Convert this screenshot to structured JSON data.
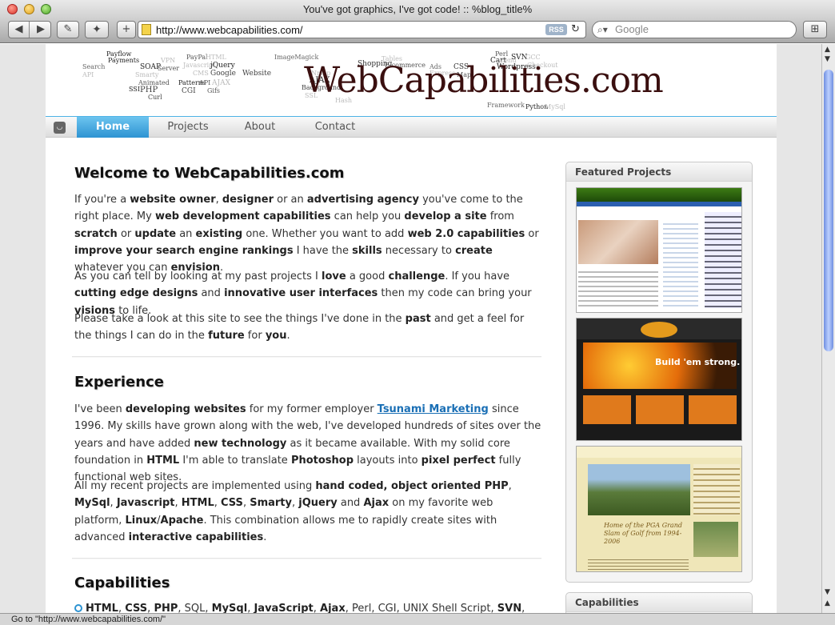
{
  "window": {
    "title": "You've got graphics, I've got code! :: %blog_title%"
  },
  "toolbar": {
    "url": "http://www.webcapabilities.com/",
    "rss": "RSS",
    "search_placeholder": "Google"
  },
  "status": {
    "text": "Go to \"http://www.webcapabilities.com/\""
  },
  "banner": {
    "logo": "WebCapabilities.com",
    "tags": [
      {
        "t": "Payflow",
        "s": 8,
        "c": "#222"
      },
      {
        "t": "Payments",
        "s": 8,
        "c": "#222"
      },
      {
        "t": "Search",
        "s": 8,
        "c": "#666"
      },
      {
        "t": "API",
        "s": 8,
        "c": "#bbb"
      },
      {
        "t": "VPN",
        "s": 8,
        "c": "#bbb"
      },
      {
        "t": "SOAP",
        "s": 9,
        "c": "#222"
      },
      {
        "t": "Smarty",
        "s": 8,
        "c": "#bbb"
      },
      {
        "t": "Server",
        "s": 8,
        "c": "#555"
      },
      {
        "t": "Animated",
        "s": 8,
        "c": "#555"
      },
      {
        "t": "SSI",
        "s": 8,
        "c": "#222"
      },
      {
        "t": "PHP",
        "s": 10,
        "c": "#444"
      },
      {
        "t": "Curl",
        "s": 8,
        "c": "#444"
      },
      {
        "t": "PayPal",
        "s": 8,
        "c": "#555"
      },
      {
        "t": "HTML",
        "s": 8,
        "c": "#bbb"
      },
      {
        "t": "Javascript",
        "s": 8,
        "c": "#bbb"
      },
      {
        "t": "jQuery",
        "s": 9,
        "c": "#222"
      },
      {
        "t": "CMS",
        "s": 8,
        "c": "#bbb"
      },
      {
        "t": "Google",
        "s": 9,
        "c": "#444"
      },
      {
        "t": "Patterns",
        "s": 8,
        "c": "#222"
      },
      {
        "t": "CGI",
        "s": 9,
        "c": "#444"
      },
      {
        "t": "API",
        "s": 8,
        "c": "#555"
      },
      {
        "t": "AJAX",
        "s": 9,
        "c": "#bbb"
      },
      {
        "t": "Gifs",
        "s": 8,
        "c": "#555"
      },
      {
        "t": "Website",
        "s": 9,
        "c": "#444"
      },
      {
        "t": "ImageMagick",
        "s": 8,
        "c": "#666"
      },
      {
        "t": "Nmap",
        "s": 8,
        "c": "#bbb"
      },
      {
        "t": "AJAX",
        "s": 10,
        "c": "#222"
      },
      {
        "t": "Background",
        "s": 8,
        "c": "#444"
      },
      {
        "t": "SSL",
        "s": 8,
        "c": "#bbb"
      },
      {
        "t": "Hash",
        "s": 8,
        "c": "#bbb"
      },
      {
        "t": "Shopping",
        "s": 9,
        "c": "#333"
      },
      {
        "t": "Tables",
        "s": 8,
        "c": "#bbb"
      },
      {
        "t": "E-commerce",
        "s": 8,
        "c": "#555"
      },
      {
        "t": "Ads",
        "s": 8,
        "c": "#666"
      },
      {
        "t": "Express",
        "s": 8,
        "c": "#bbb"
      },
      {
        "t": "CSS",
        "s": 9,
        "c": "#333"
      },
      {
        "t": "Map",
        "s": 8,
        "c": "#555"
      },
      {
        "t": "Perl",
        "s": 8,
        "c": "#555"
      },
      {
        "t": "Cart",
        "s": 9,
        "c": "#222"
      },
      {
        "t": "Zend",
        "s": 8,
        "c": "#bbb"
      },
      {
        "t": "SVN",
        "s": 9,
        "c": "#222"
      },
      {
        "t": "GCC",
        "s": 8,
        "c": "#bbb"
      },
      {
        "t": "Wordpress",
        "s": 9,
        "c": "#222"
      },
      {
        "t": "Checkout",
        "s": 8,
        "c": "#bbb"
      },
      {
        "t": "Framework",
        "s": 8,
        "c": "#666"
      },
      {
        "t": "Python",
        "s": 8,
        "c": "#222"
      },
      {
        "t": "MySql",
        "s": 8,
        "c": "#bbb"
      }
    ]
  },
  "nav": {
    "items": [
      "Home",
      "Projects",
      "About",
      "Contact"
    ],
    "active": "Home"
  },
  "welcome": {
    "title": "Welcome to WebCapabilities.com",
    "paragraphs": [
      [
        [
          "",
          "If you're a "
        ],
        [
          "b",
          "website owner"
        ],
        [
          "",
          ", "
        ],
        [
          "b",
          "designer"
        ],
        [
          "",
          " or an "
        ],
        [
          "b",
          "advertising agency"
        ],
        [
          "",
          " you've come to the right place. My "
        ],
        [
          "b",
          "web development capabilities"
        ],
        [
          "",
          " can help you "
        ],
        [
          "b",
          "develop a site"
        ],
        [
          "",
          " from "
        ],
        [
          "b",
          "scratch"
        ],
        [
          "",
          " or "
        ],
        [
          "b",
          "update"
        ],
        [
          "",
          " an "
        ],
        [
          "b",
          "existing"
        ],
        [
          "",
          " one. Whether you want to add "
        ],
        [
          "b",
          "web 2.0 capabilities"
        ],
        [
          "",
          " or "
        ],
        [
          "b",
          "improve your search engine rankings"
        ],
        [
          "",
          " I have the "
        ],
        [
          "b",
          "skills"
        ],
        [
          "",
          " necessary to "
        ],
        [
          "b",
          "create"
        ],
        [
          "",
          " whatever you can "
        ],
        [
          "b",
          "envision"
        ],
        [
          "",
          "."
        ]
      ],
      [
        [
          "",
          "As you can tell by looking at my past projects I "
        ],
        [
          "b",
          "love"
        ],
        [
          "",
          " a good "
        ],
        [
          "b",
          "challenge"
        ],
        [
          "",
          ". If you have "
        ],
        [
          "b",
          "cutting edge designs"
        ],
        [
          "",
          " and "
        ],
        [
          "b",
          "innovative user interfaces"
        ],
        [
          "",
          " then my code can bring your "
        ],
        [
          "b",
          "visions"
        ],
        [
          "",
          " to life."
        ]
      ],
      [
        [
          "",
          "Please take a look at this site to see the things I've done in the "
        ],
        [
          "b",
          "past"
        ],
        [
          "",
          " and get a feel for the things I can do in the "
        ],
        [
          "b",
          "future"
        ],
        [
          "",
          " for "
        ],
        [
          "b",
          "you"
        ],
        [
          "",
          "."
        ]
      ]
    ]
  },
  "experience": {
    "title": "Experience",
    "paragraphs": [
      [
        [
          "",
          "I've been "
        ],
        [
          "b",
          "developing websites"
        ],
        [
          "",
          " for my former employer "
        ],
        [
          "a",
          "Tsunami Marketing"
        ],
        [
          "",
          " since 1996. My skills have grown along with the web, I've developed hundreds of sites over the years and have added "
        ],
        [
          "b",
          "new technology"
        ],
        [
          "",
          " as it became available. With my solid core foundation in "
        ],
        [
          "b",
          "HTML"
        ],
        [
          "",
          " I'm able to translate "
        ],
        [
          "b",
          "Photoshop"
        ],
        [
          "",
          " layouts into "
        ],
        [
          "b",
          "pixel perfect"
        ],
        [
          "",
          " fully functional web sites."
        ]
      ],
      [
        [
          "",
          "All my recent projects are implemented using "
        ],
        [
          "b",
          "hand coded, object oriented PHP"
        ],
        [
          "",
          ", "
        ],
        [
          "b",
          "MySql"
        ],
        [
          "",
          ", "
        ],
        [
          "b",
          "Javascript"
        ],
        [
          "",
          ", "
        ],
        [
          "b",
          "HTML"
        ],
        [
          "",
          ", "
        ],
        [
          "b",
          "CSS"
        ],
        [
          "",
          ", "
        ],
        [
          "b",
          "Smarty"
        ],
        [
          "",
          ", "
        ],
        [
          "b",
          "jQuery"
        ],
        [
          "",
          " and "
        ],
        [
          "b",
          "Ajax"
        ],
        [
          "",
          " on my favorite web platform, "
        ],
        [
          "b",
          "Linux"
        ],
        [
          "",
          "/"
        ],
        [
          "b",
          "Apache"
        ],
        [
          "",
          ". This combination allows me to rapidly create sites with advanced "
        ],
        [
          "b",
          "interactive capabilities"
        ],
        [
          "",
          "."
        ]
      ]
    ]
  },
  "capabilities": {
    "title": "Capabilities",
    "line": [
      [
        "b",
        "HTML"
      ],
      [
        "",
        ", "
      ],
      [
        "b",
        "CSS"
      ],
      [
        "",
        ", "
      ],
      [
        "b",
        "PHP"
      ],
      [
        "",
        ", SQL, "
      ],
      [
        "b",
        "MySql"
      ],
      [
        "",
        ", "
      ],
      [
        "b",
        "JavaScript"
      ],
      [
        "",
        ", "
      ],
      [
        "b",
        "Ajax"
      ],
      [
        "",
        ", Perl, CGI, UNIX Shell Script, "
      ],
      [
        "b",
        "SVN"
      ],
      [
        "",
        ","
      ]
    ]
  },
  "sidebar": {
    "featured_title": "Featured Projects",
    "capabilities_title": "Capabilities",
    "thumb2_slogan": "Build 'em strong.",
    "thumb3_caption": "Home of the PGA Grand Slam of Golf from 1994-2006"
  },
  "colors": {
    "accent": "#3aa3dd",
    "link": "#1a6fb5",
    "logo": "#3a0f0f"
  }
}
